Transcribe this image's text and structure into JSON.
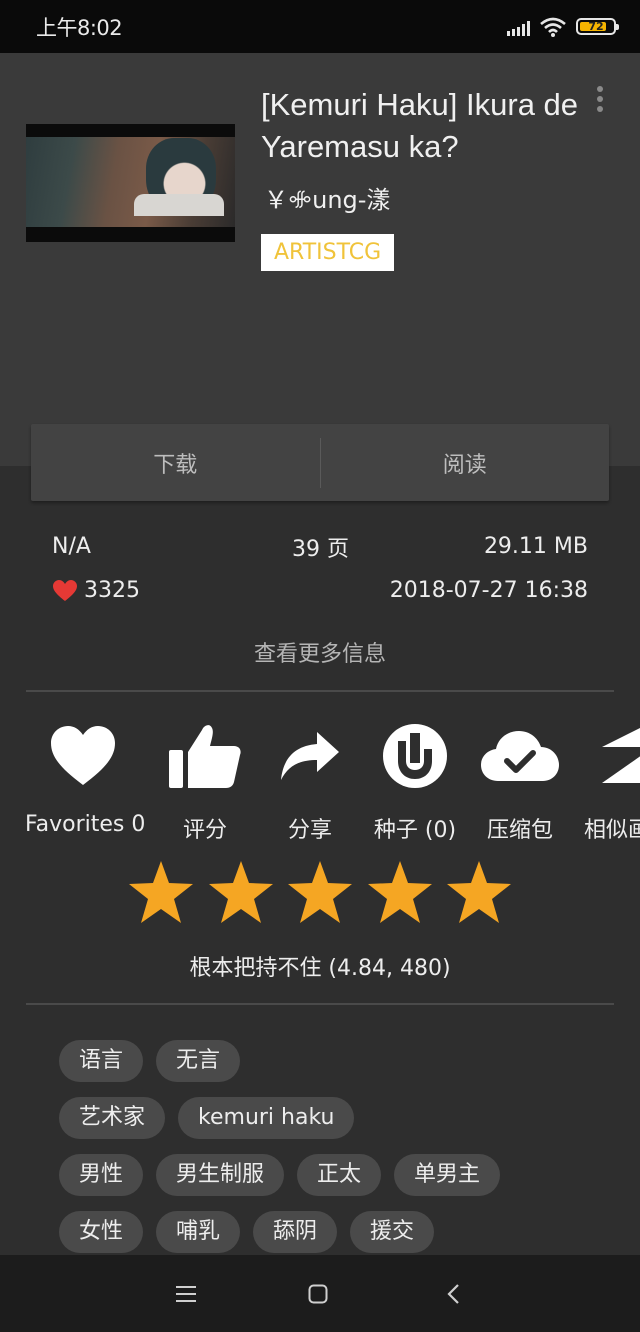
{
  "status": {
    "time": "上午8:02",
    "battery": "72"
  },
  "gallery": {
    "title": "[Kemuri Haku] Ikura de Yaremasu ka?",
    "uploader": "￥ꗂung-漾",
    "category": "ARTISTCG",
    "accent": "#f0c33a"
  },
  "actions": {
    "download": "下载",
    "read": "阅读"
  },
  "info": {
    "language": "N/A",
    "pages": "39 页",
    "size": "29.11 MB",
    "favorites": "3325",
    "posted": "2018-07-27 16:38",
    "more": "查看更多信息"
  },
  "icons": [
    {
      "name": "heart-icon",
      "label": "Favorites 0"
    },
    {
      "name": "thumbs-up-icon",
      "label": "评分"
    },
    {
      "name": "share-icon",
      "label": "分享"
    },
    {
      "name": "utorrent-icon",
      "label": "种子 (0)"
    },
    {
      "name": "cloud-check-icon",
      "label": "压缩包"
    },
    {
      "name": "similar-icon",
      "label": "相似画"
    }
  ],
  "rating": {
    "stars": 5,
    "text": "根本把持不住 (4.84, 480)",
    "star_color": "#f5a623"
  },
  "tags": [
    [
      "语言",
      "无言"
    ],
    [
      "艺术家",
      "kemuri haku"
    ],
    [
      "男性",
      "男生制服",
      "正太",
      "单男主"
    ],
    [
      "女性",
      "哺乳",
      "舔阴",
      "援交"
    ]
  ]
}
